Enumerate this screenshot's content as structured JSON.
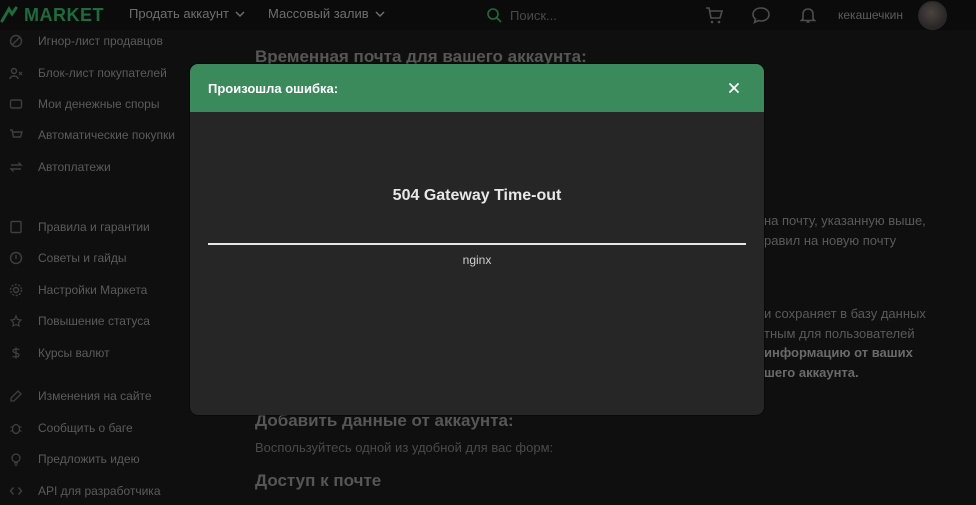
{
  "topbar": {
    "logo_text": "MARKET",
    "nav": [
      "Продать аккаунт",
      "Массовый залив"
    ],
    "search_placeholder": "Поиск...",
    "username": "кекашечкин"
  },
  "sidebar": {
    "items": [
      {
        "label": "Игнор-лист продавцов",
        "icon": "ignore-list-icon"
      },
      {
        "label": "Блок-лист покупателей",
        "icon": "block-list-icon"
      },
      {
        "label": "Мои денежные споры",
        "icon": "disputes-icon"
      },
      {
        "label": "Автоматические покупки",
        "icon": "cart-icon"
      },
      {
        "label": "Автоплатежи",
        "icon": "autopay-icon"
      },
      {
        "label": "Правила и гарантии",
        "icon": "rules-icon"
      },
      {
        "label": "Советы и гайды",
        "icon": "guides-icon"
      },
      {
        "label": "Настройки Маркета",
        "icon": "settings-icon"
      },
      {
        "label": "Повышение статуса",
        "icon": "status-icon"
      },
      {
        "label": "Курсы валют",
        "icon": "currency-icon"
      },
      {
        "label": "Изменения на сайте",
        "icon": "changes-icon"
      },
      {
        "label": "Сообщить о баге",
        "icon": "bug-icon"
      },
      {
        "label": "Предложить идею",
        "icon": "idea-icon"
      },
      {
        "label": "API для разработчика",
        "icon": "api-icon"
      }
    ]
  },
  "main": {
    "heading_temp_mail": "Временная почта для вашего аккаунта:",
    "fragments": [
      "на почту, указанную выше,",
      "равил на новую почту",
      "и сохраняет в базу данных",
      "тным для пользователей",
      "информацию от ваших",
      "шего аккаунта."
    ],
    "heading_add_data": "Добавить данные от аккаунта:",
    "add_data_hint": "Воспользуйтесь одной из удобной для вас форм:",
    "heading_mail_access": "Доступ к почте"
  },
  "modal": {
    "title": "Произошла ошибка:",
    "error_title": "504 Gateway Time-out",
    "error_server": "nginx"
  },
  "colors": {
    "modal_header": "#3a8a5c",
    "modal_bg": "#262626",
    "brand_green": "#1e6b3b"
  }
}
